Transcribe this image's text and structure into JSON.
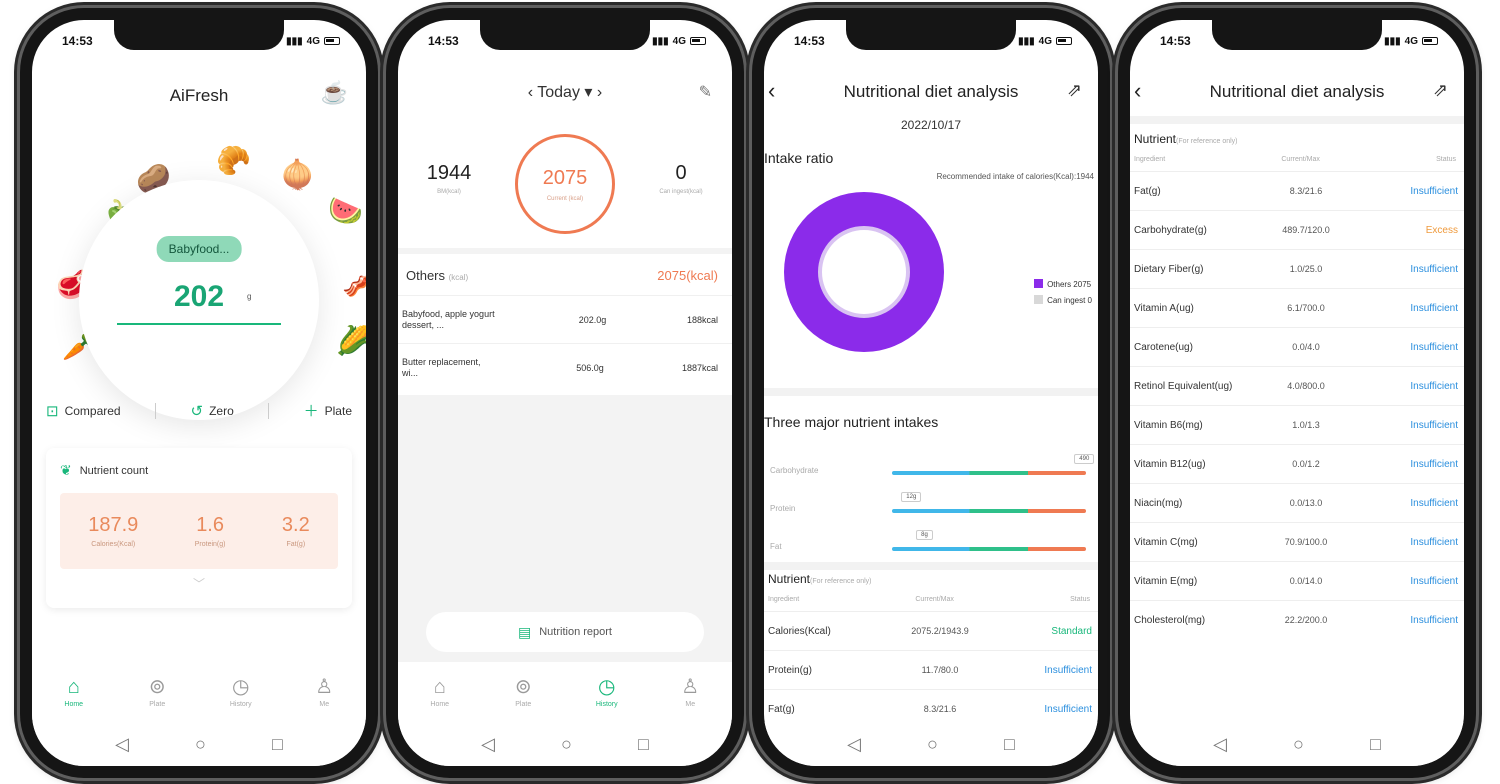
{
  "status": {
    "time": "14:53",
    "network": "4G"
  },
  "home": {
    "title": "AiFresh",
    "food_chip": "Babyfood...",
    "weight": "202",
    "weight_unit": "g",
    "actions": {
      "compared": "Compared",
      "zero": "Zero",
      "plate": "Plate"
    },
    "nutrient": {
      "title": "Nutrient count",
      "items": [
        {
          "value": "187.9",
          "label": "Calories(Kcal)"
        },
        {
          "value": "1.6",
          "label": "Protein(g)"
        },
        {
          "value": "3.2",
          "label": "Fat(g)"
        }
      ]
    }
  },
  "tabs": [
    "Home",
    "Plate",
    "History",
    "Me"
  ],
  "diary": {
    "date": "Today",
    "left": {
      "value": "1944",
      "label": "BM(kcal)"
    },
    "center": {
      "value": "2075",
      "label": "Current (kcal)"
    },
    "right": {
      "value": "0",
      "label": "Can ingest(kcal)"
    },
    "meal": {
      "name": "Others",
      "unit": "(kcal)",
      "total": "2075(kcal)"
    },
    "foods": [
      {
        "name": "Babyfood, apple yogurt dessert, ...",
        "weight": "202.0g",
        "kcal": "188kcal"
      },
      {
        "name": "Butter replacement, wi...",
        "weight": "506.0g",
        "kcal": "1887kcal"
      }
    ],
    "report_button": "Nutrition report"
  },
  "analysis": {
    "title": "Nutritional diet analysis",
    "date": "2022/10/17",
    "intake_ratio": "Intake ratio",
    "recommended": "Recommended intake of calories(Kcal):1944",
    "legend": [
      {
        "label": "Others 2075",
        "color": "#8b2bea"
      },
      {
        "label": "Can ingest 0",
        "color": "#d8d8d8"
      }
    ],
    "major_title": "Three major nutrient intakes",
    "major": [
      {
        "name": "Carbohydrate",
        "marker": "490",
        "level": 0.98
      },
      {
        "name": "Protein",
        "marker": "12g",
        "level": 0.05
      },
      {
        "name": "Fat",
        "marker": "8g",
        "level": 0.13
      }
    ],
    "table_title": "Nutrient",
    "table_ref": "(For reference only)",
    "columns": [
      "Ingredient",
      "Current/Max",
      "Status"
    ],
    "rows_phone3": [
      {
        "name": "Calories(Kcal)",
        "value": "2075.2/1943.9",
        "status": "Standard"
      },
      {
        "name": "Protein(g)",
        "value": "11.7/80.0",
        "status": "Insufficient"
      },
      {
        "name": "Fat(g)",
        "value": "8.3/21.6",
        "status": "Insufficient"
      }
    ],
    "rows_phone4": [
      {
        "name": "Fat(g)",
        "value": "8.3/21.6",
        "status": "Insufficient"
      },
      {
        "name": "Carbohydrate(g)",
        "value": "489.7/120.0",
        "status": "Excess"
      },
      {
        "name": "Dietary Fiber(g)",
        "value": "1.0/25.0",
        "status": "Insufficient"
      },
      {
        "name": "Vitamin A(ug)",
        "value": "6.1/700.0",
        "status": "Insufficient"
      },
      {
        "name": "Carotene(ug)",
        "value": "0.0/4.0",
        "status": "Insufficient"
      },
      {
        "name": "Retinol Equivalent(ug)",
        "value": "4.0/800.0",
        "status": "Insufficient"
      },
      {
        "name": "Vitamin B6(mg)",
        "value": "1.0/1.3",
        "status": "Insufficient"
      },
      {
        "name": "Vitamin B12(ug)",
        "value": "0.0/1.2",
        "status": "Insufficient"
      },
      {
        "name": "Niacin(mg)",
        "value": "0.0/13.0",
        "status": "Insufficient"
      },
      {
        "name": "Vitamin C(mg)",
        "value": "70.9/100.0",
        "status": "Insufficient"
      },
      {
        "name": "Vitamin E(mg)",
        "value": "0.0/14.0",
        "status": "Insufficient"
      },
      {
        "name": "Cholesterol(mg)",
        "value": "22.2/200.0",
        "status": "Insufficient"
      }
    ]
  }
}
